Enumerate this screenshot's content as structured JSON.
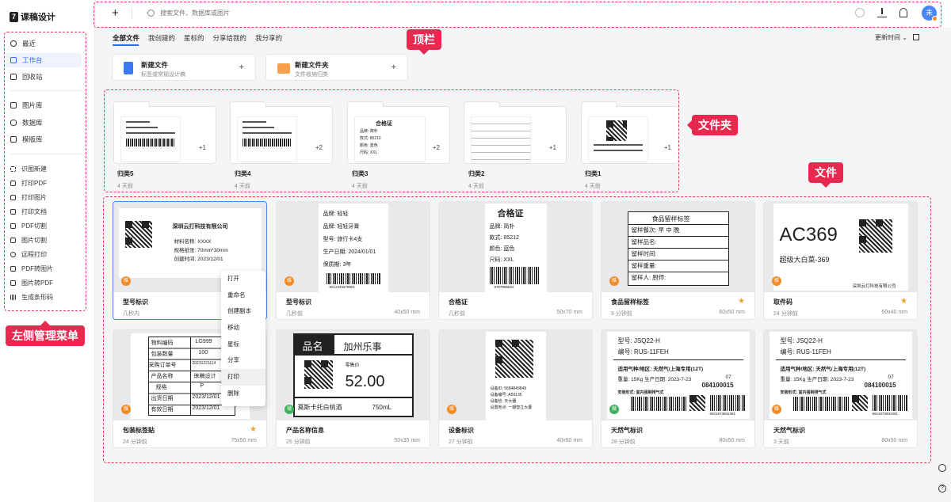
{
  "app": {
    "logo_mark": "7",
    "logo_text": "课稿设计"
  },
  "sidebar": {
    "group1": [
      {
        "label": "最近",
        "icon": "clock-icon"
      },
      {
        "label": "工作台",
        "icon": "workspace-icon",
        "active": true
      },
      {
        "label": "回收站",
        "icon": "trash-icon"
      }
    ],
    "group2": [
      {
        "label": "图片库",
        "icon": "image-icon"
      },
      {
        "label": "数据库",
        "icon": "database-icon"
      },
      {
        "label": "模版库",
        "icon": "template-icon"
      }
    ],
    "group3": [
      {
        "label": "识图新建",
        "icon": "scan-icon"
      },
      {
        "label": "打印PDF",
        "icon": "print-icon"
      },
      {
        "label": "打印图片",
        "icon": "print-icon"
      },
      {
        "label": "打印文档",
        "icon": "print-icon"
      },
      {
        "label": "PDF切割",
        "icon": "pdf-icon"
      },
      {
        "label": "图片切割",
        "icon": "image-cut-icon"
      },
      {
        "label": "远程打印",
        "icon": "cloud-print-icon"
      },
      {
        "label": "PDF转图片",
        "icon": "convert-icon"
      },
      {
        "label": "图片转PDF",
        "icon": "convert-icon"
      },
      {
        "label": "生成条形码",
        "icon": "barcode-icon"
      }
    ]
  },
  "callouts": {
    "topbar": "顶栏",
    "folders": "文件夹",
    "files": "文件",
    "sidebar": "左侧管理菜单"
  },
  "topbar": {
    "add": "+",
    "search_placeholder": "搜索文件、数据库或图片",
    "avatar": "未"
  },
  "tabs": [
    {
      "label": "全部文件",
      "active": true
    },
    {
      "label": "我创建的"
    },
    {
      "label": "星标的"
    },
    {
      "label": "分享给我的"
    },
    {
      "label": "我分享的"
    }
  ],
  "sort": {
    "label": "更新时间 ⌄"
  },
  "new_cards": [
    {
      "title": "新建文件",
      "sub": "标签或常规设计稿",
      "plus": "+",
      "color": "#3a7bf5"
    },
    {
      "title": "新建文件夹",
      "sub": "文件收纳归类",
      "plus": "+",
      "color": "#f5a04a"
    }
  ],
  "folders": [
    {
      "name": "归类5",
      "time": "4 天前",
      "count": "+1"
    },
    {
      "name": "归类4",
      "time": "4 天前",
      "count": "+2"
    },
    {
      "name": "归类3",
      "time": "4 天前",
      "count": "+2"
    },
    {
      "name": "归类2",
      "time": "4 天前",
      "count": "+1"
    },
    {
      "name": "归类1",
      "time": "4 天前",
      "count": "+1"
    }
  ],
  "folder_preview_text": {
    "f3_title": "合格证",
    "f3_rows": [
      "品牌: 简朴",
      "款式: 85212",
      "颜色: 蓝色",
      "尺码: XXL"
    ]
  },
  "files": [
    {
      "title": "型号标识",
      "time": "几秒内",
      "size": "",
      "tag": "维",
      "star": false,
      "lines": [
        "深圳云打科技有限公司",
        "材料名称: XXXX",
        "规格纸张: 70mm*30mm",
        "创建时间: 2023/12/01"
      ]
    },
    {
      "title": "型号标识",
      "time": "几秒前",
      "size": "40x50 mm",
      "tag": "维",
      "star": false,
      "lines": [
        "品牌: 轻轻",
        "品牌: 轻轻牙膏",
        "型号: 旅行卡4支",
        "生产日期: 2024/01/01",
        "保质期: 3年",
        "8012345678901"
      ]
    },
    {
      "title": "合格证",
      "time": "几秒前",
      "size": "50x70 mm",
      "tag": "",
      "star": false,
      "lines": [
        "合格证",
        "品牌: 简朴",
        "款式: 85212",
        "颜色: 蓝色",
        "尺码: XXL",
        "9787985622"
      ]
    },
    {
      "title": "食品留样标签",
      "time": "9 分钟前",
      "size": "60x50 mm",
      "tag": "维",
      "star": true,
      "lines": [
        "食品留样标签",
        "留样餐次: 早  中  晚",
        "留样品名:",
        "留样时间:",
        "留样重量:",
        "留样人:        厨师:"
      ]
    },
    {
      "title": "取件码",
      "time": "24 分钟前",
      "size": "60x40 mm",
      "tag": "维",
      "star": true,
      "lines": [
        "AC369",
        "超级大白菜-369",
        "深圳云打科技有限公司"
      ]
    },
    {
      "title": "包装标签贴",
      "time": "24 分钟前",
      "size": "75x50 mm",
      "tag": "维",
      "star": true,
      "lines": [
        "物料编码",
        "LG999",
        "包装数量",
        "100",
        "采购订单号",
        "20231221114",
        "产品名称",
        "徕稿设计",
        "规格",
        "P",
        "出货日期",
        "2023/12/01",
        "有效日期",
        "2023/12/01"
      ]
    },
    {
      "title": "产品名称信息",
      "time": "25 分钟前",
      "size": "50x35 mm",
      "tag": "微",
      "star": false,
      "lines": [
        "品名",
        "加州乐事",
        "零售价",
        "52.00",
        "莫斯卡托白桃酒",
        "750mL"
      ]
    },
    {
      "title": "设备标识",
      "time": "27 分钟前",
      "size": "40x60 mm",
      "tag": "维",
      "star": false,
      "lines": [
        "设备ID: 5684849849",
        "设备编号: A59135",
        "设备检: 天大器",
        "设置地点: 一期智立大厦"
      ]
    },
    {
      "title": "天然气标识",
      "time": "28 分钟前",
      "size": "80x50 mm",
      "tag": "微",
      "star": false,
      "lines": [
        "型号: JSQ22-H",
        "编号: RUS-11FEH",
        "适用气种/地区: 天然气/上海专用(12T)",
        "重量: 15Kg  生产日期: 2023-7-23",
        "07",
        "084100015",
        "安装形式: 室内强制排气式",
        "6921873802381"
      ]
    },
    {
      "title": "天然气标识",
      "time": "3 天前",
      "size": "80x50 mm",
      "tag": "维",
      "star": false,
      "lines": [
        "型号: JSQ22-H",
        "编号: RUS-11FEH",
        "适用气种/地区: 天然气/上海专用(12T)",
        "重量: 15Kg  生产日期: 2023-7-23",
        "07",
        "084100015",
        "安装形式: 室内强制排气式",
        "6921873802381"
      ]
    }
  ],
  "context_menu": [
    "打开",
    "重命名",
    "创建副本",
    "移动",
    "星标",
    "分享",
    "打印",
    "删除"
  ],
  "colors": {
    "accent": "#2f6cf6",
    "callout": "#e8294f",
    "tag_orange": "#f28c28",
    "tag_green": "#3fb15d",
    "star": "#f0a22a"
  }
}
